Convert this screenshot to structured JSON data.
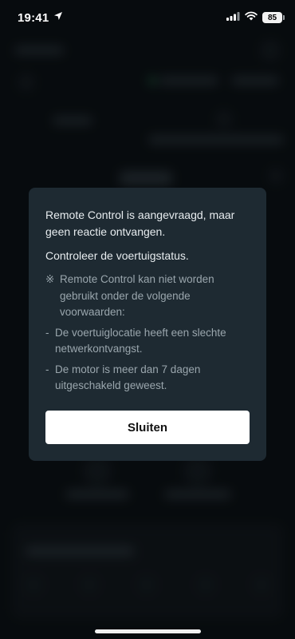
{
  "status_bar": {
    "time": "19:41",
    "battery": "85",
    "icons": [
      "location-arrow-icon",
      "cellular-signal-icon",
      "wifi-icon",
      "battery-icon"
    ]
  },
  "dialog": {
    "message": "Remote Control is aangevraagd, maar geen reactie ontvangen.",
    "instruction": "Controleer de voertuigstatus.",
    "note_symbol": "※",
    "note": "Remote Control kan niet worden gebruikt onder de volgende voorwaarden:",
    "bullet_symbol": "-",
    "conditions": [
      "De voertuiglocatie heeft een slechte netwerkontvangst.",
      "De motor is meer dan 7 dagen uitgeschakeld geweest."
    ],
    "close_label": "Sluiten"
  },
  "colors": {
    "background": "#0b1115",
    "dialog": "#1e2a32",
    "primary_text": "#e7ecef",
    "secondary_text": "#9aa6ad",
    "button": "#ffffff",
    "button_text": "#111111"
  }
}
